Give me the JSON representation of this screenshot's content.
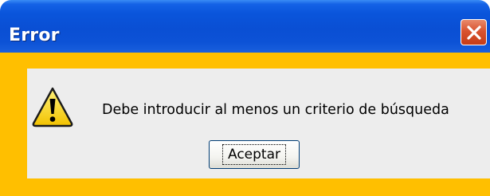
{
  "window": {
    "title": "Error",
    "close_icon": "close-icon"
  },
  "dialog": {
    "icon": "warning-icon",
    "message": "Debe introducir al menos un criterio de búsqueda",
    "ok_label": "Aceptar"
  },
  "colors": {
    "titlebar": "#0a55db",
    "frame": "#ffbf00",
    "panel": "#ededed",
    "close_button": "#d9532f"
  }
}
